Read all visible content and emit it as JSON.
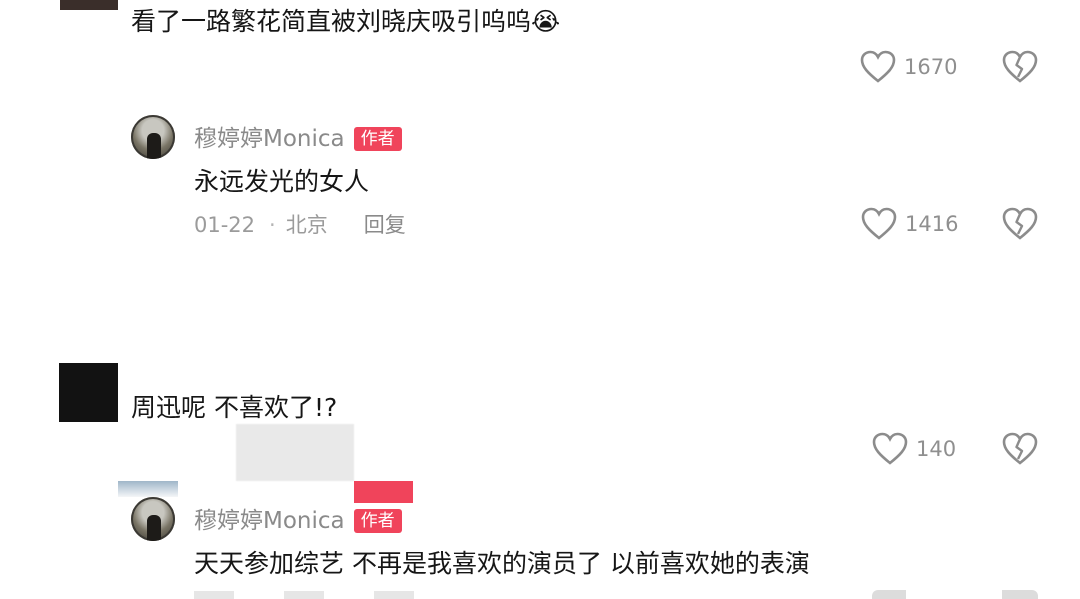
{
  "comments": [
    {
      "text": "看了一路繁花简直被刘晓庆吸引呜呜😭",
      "likes": "1670"
    },
    {
      "text": "周迅呢 不喜欢了!?",
      "likes": "140"
    }
  ],
  "replies": [
    {
      "username": "穆婷婷Monica",
      "badge": "作者",
      "text": "永远发光的女人",
      "date": "01-22",
      "separator": "·",
      "location": "北京",
      "reply_label": "回复",
      "likes": "1416"
    },
    {
      "username": "穆婷婷Monica",
      "badge": "作者",
      "text": "天天参加综艺 不再是我喜欢的演员了 以前喜欢她的表演"
    }
  ],
  "colors": {
    "badge": "#f0445b",
    "muted": "#8a8a8a",
    "text": "#161616"
  },
  "icons": {
    "like": "heart-outline-icon",
    "dislike": "broken-heart-icon"
  }
}
